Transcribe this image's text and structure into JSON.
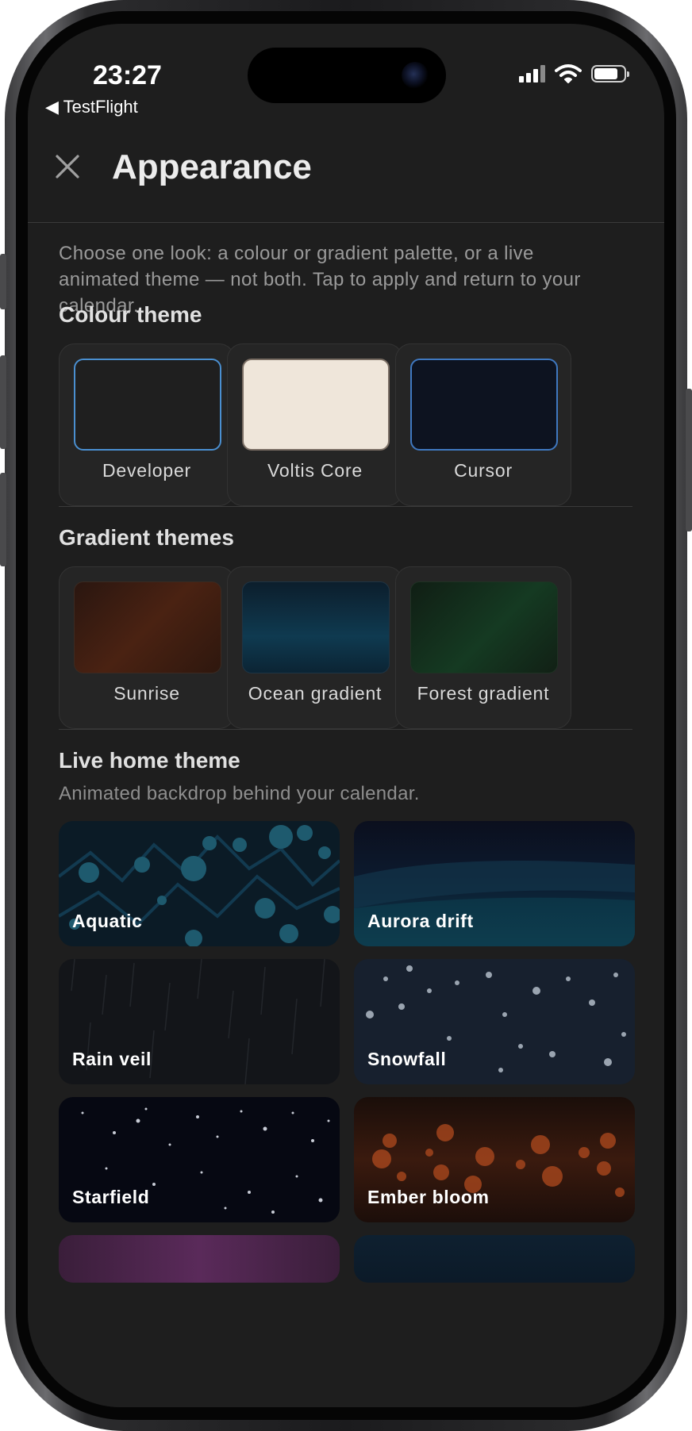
{
  "status": {
    "time": "23:27",
    "back_app": "◀ TestFlight"
  },
  "header": {
    "title": "Appearance"
  },
  "intro": "Choose one look: a colour or gradient palette, or a live animated theme — not both. Tap to apply and return to your calendar.",
  "colour_theme": {
    "title": "Colour theme",
    "items": [
      {
        "label": "Developer"
      },
      {
        "label": "Voltis Core"
      },
      {
        "label": "Cursor"
      }
    ]
  },
  "gradient_themes": {
    "title": "Gradient themes",
    "items": [
      {
        "label": "Sunrise"
      },
      {
        "label": "Ocean gradient"
      },
      {
        "label": "Forest gradient"
      }
    ]
  },
  "live_home": {
    "title": "Live home theme",
    "subtitle": "Animated backdrop behind your calendar.",
    "items": [
      {
        "label": "Aquatic"
      },
      {
        "label": "Aurora drift"
      },
      {
        "label": "Rain veil"
      },
      {
        "label": "Snowfall"
      },
      {
        "label": "Starfield"
      },
      {
        "label": "Ember bloom"
      }
    ]
  },
  "colors": {
    "background": "#1e1e1e",
    "selection_border": "#4a8fd0",
    "card": "#252525"
  }
}
